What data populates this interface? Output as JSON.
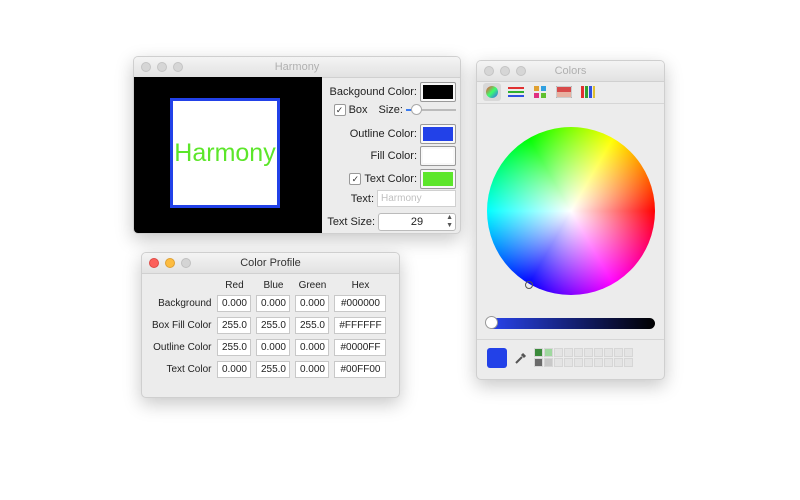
{
  "harmony_window": {
    "title": "Harmony",
    "preview_text": "Harmony",
    "background_label": "Backgound Color:",
    "box_label": "Box",
    "size_label": "Size:",
    "size_value": 0.12,
    "outline_label": "Outline Color:",
    "fill_label": "Fill Color:",
    "text_color_label": "Text Color:",
    "text_label": "Text:",
    "text_placeholder": "Harmony",
    "text_size_label": "Text Size:",
    "text_size_value": "29",
    "box_checked": "✓",
    "text_color_checked": "✓",
    "colors": {
      "background": "#000000",
      "outline": "#2241e8",
      "fill": "#ffffff",
      "text": "#5ce62a"
    }
  },
  "profile_window": {
    "title": "Color Profile",
    "headers": [
      "Red",
      "Blue",
      "Green",
      "Hex"
    ],
    "rows": [
      {
        "label": "Background",
        "red": "0.000",
        "blue": "0.000",
        "green": "0.000",
        "hex": "#000000"
      },
      {
        "label": "Box Fill Color",
        "red": "255.0",
        "blue": "255.0",
        "green": "255.0",
        "hex": "#FFFFFF"
      },
      {
        "label": "Outline Color",
        "red": "255.0",
        "blue": "0.000",
        "green": "0.000",
        "hex": "#0000FF"
      },
      {
        "label": "Text Color",
        "red": "0.000",
        "blue": "255.0",
        "green": "0.000",
        "hex": "#00FF00"
      }
    ]
  },
  "colors_panel": {
    "title": "Colors",
    "tabs": [
      "color-wheel-icon",
      "sliders-icon",
      "palettes-icon",
      "image-palettes-icon",
      "crayons-icon"
    ],
    "current_color": "#2241e8",
    "brightness": 0.0
  }
}
